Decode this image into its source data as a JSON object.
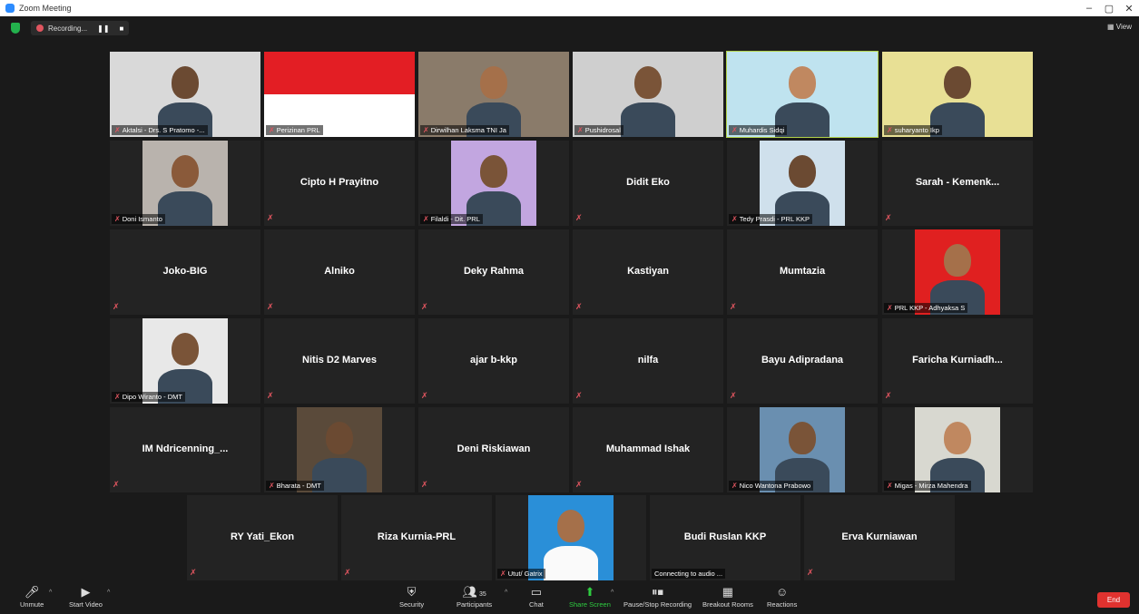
{
  "window": {
    "title": "Zoom Meeting",
    "minimize": "–",
    "restore": "▢",
    "close": "✕"
  },
  "top": {
    "recording_label": "Recording...",
    "pause": "❚❚",
    "stop": "■",
    "view_label": "View"
  },
  "tiles": [
    {
      "name": "Aktalsi - Drs. S Pratomo -...",
      "video": true,
      "bg": "#d9d9d9"
    },
    {
      "name": "Perizinan PRL",
      "video": true,
      "bg": "#ffffff"
    },
    {
      "name": "Dirwilhan Laksma TNI Ja",
      "video": true,
      "bg": "#8a7b6a"
    },
    {
      "name": "Pushidrosal",
      "video": true,
      "bg": "#cfcfcf"
    },
    {
      "name": "Muhardis Sidqi",
      "video": true,
      "bg": "#bfe3ef"
    },
    {
      "name": "suharyanto Ikp",
      "video": true,
      "bg": "#e8e095"
    },
    {
      "name": "Doni Ismanto",
      "video": true,
      "bg": "#b9b3ad"
    },
    {
      "name": "Cipto H Prayitno",
      "video": false
    },
    {
      "name": "Filaldi - Dit. PRL",
      "video": true,
      "bg": "#c2a6e0"
    },
    {
      "name": "Didit Eko",
      "video": false
    },
    {
      "name": "Tedy Prasdi - PRL KKP",
      "video": true,
      "bg": "#cfe0ec"
    },
    {
      "name": "Sarah - Kemenk...",
      "video": false
    },
    {
      "name": "Joko-BIG",
      "video": false
    },
    {
      "name": "Alniko",
      "video": false
    },
    {
      "name": "Deky Rahma",
      "video": false
    },
    {
      "name": "Kastiyan",
      "video": false
    },
    {
      "name": "Mumtazia",
      "video": false
    },
    {
      "name": "PRL KKP - Adhyaksa S",
      "video": true,
      "bg": "#e02020"
    },
    {
      "name": "Dipo Wiranto - DMT",
      "video": true,
      "bg": "#e8e8e8"
    },
    {
      "name": "Nitis D2 Marves",
      "video": false
    },
    {
      "name": "ajar b-kkp",
      "video": false
    },
    {
      "name": "nilfa",
      "video": false
    },
    {
      "name": "Bayu Adipradana",
      "video": false
    },
    {
      "name": "Faricha Kurniadh...",
      "video": false
    },
    {
      "name": "IM Ndricenning_...",
      "video": false
    },
    {
      "name": "Bharata - DMT",
      "video": true,
      "bg": "#5a4a3a"
    },
    {
      "name": "Deni Riskiawan",
      "video": false
    },
    {
      "name": "Muhammad Ishak",
      "video": false
    },
    {
      "name": "Nico Wantona Prabowo",
      "video": true,
      "bg": "#6a8fb0"
    },
    {
      "name": "Migas - Mirza Mahendra",
      "video": true,
      "bg": "#d8d8d0"
    },
    {
      "name": "RY Yati_Ekon",
      "video": false
    },
    {
      "name": "Riza Kurnia-PRL",
      "video": false
    },
    {
      "name": "Utut/ Gatrix",
      "video": true,
      "bg": "#2a8fd8"
    },
    {
      "name": "Budi Ruslan KKP",
      "video": false,
      "status": "Connecting to audio ..."
    },
    {
      "name": "Erva Kurniawan",
      "video": false
    }
  ],
  "toolbar": {
    "unmute": "Unmute",
    "start_video": "Start Video",
    "security": "Security",
    "participants": "Participants",
    "participants_count": "35",
    "chat": "Chat",
    "share_screen": "Share Screen",
    "pause_stop_recording": "Pause/Stop Recording",
    "breakout_rooms": "Breakout Rooms",
    "reactions": "Reactions",
    "end": "End"
  },
  "colors": {
    "accent_green": "#2ecc40",
    "end_red": "#e0322f",
    "highlight": "#b3d34a",
    "mute_red": "#e0555f"
  }
}
